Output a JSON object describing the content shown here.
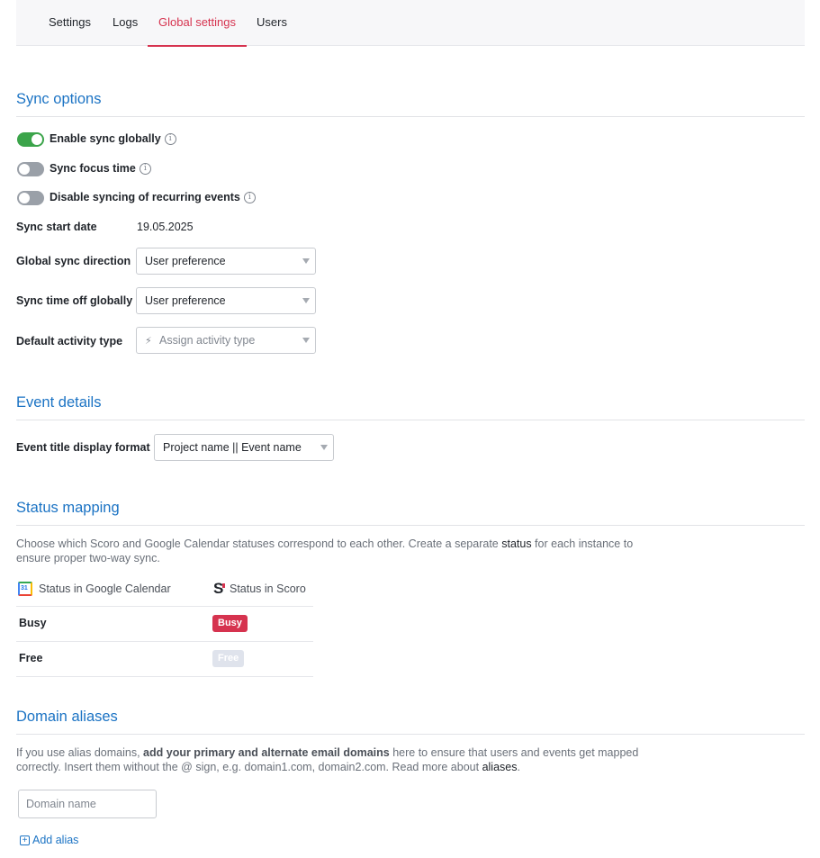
{
  "tabs": [
    {
      "label": "Settings"
    },
    {
      "label": "Logs"
    },
    {
      "label": "Global settings",
      "active": true
    },
    {
      "label": "Users"
    }
  ],
  "sync": {
    "title": "Sync options",
    "toggles": [
      {
        "label": "Enable sync globally",
        "on": true
      },
      {
        "label": "Sync focus time",
        "on": false
      },
      {
        "label": "Disable syncing of recurring events",
        "on": false
      }
    ],
    "start_date_label": "Sync start date",
    "start_date_value": "19.05.2025",
    "direction_label": "Global sync direction",
    "direction_value": "User preference",
    "time_off_label": "Sync time off globally",
    "time_off_value": "User preference",
    "activity_label": "Default activity type",
    "activity_placeholder": "Assign activity type"
  },
  "event": {
    "title": "Event details",
    "format_label": "Event title display format",
    "format_value": "Project name || Event name"
  },
  "status": {
    "title": "Status mapping",
    "desc_1": "Choose which Scoro and Google Calendar statuses correspond to each other. Create a separate ",
    "desc_link": "status",
    "desc_2": " for each instance to ensure proper two-way sync.",
    "col_google": "Status in Google Calendar",
    "col_scoro": "Status in Scoro",
    "gcal_day": "31",
    "scoro_letter": "S",
    "rows": [
      {
        "google": "Busy",
        "scoro": "Busy"
      },
      {
        "google": "Free",
        "scoro": "Free"
      }
    ]
  },
  "domains": {
    "title": "Domain aliases",
    "desc_1": "If you use alias domains, ",
    "desc_bold": "add your primary and alternate email domains",
    "desc_2": " here to ensure that users and events get mapped correctly. Insert them without the @ sign, e.g. domain1.com, domain2.com. Read more about ",
    "desc_link": "aliases",
    "desc_3": ".",
    "input_placeholder": "Domain name",
    "add_label": "Add alias"
  },
  "icons": {
    "info": "info-circle-icon",
    "bolt": "lightning-icon",
    "caret": "caret-down-icon",
    "plus": "plus-square-icon"
  },
  "colors": {
    "accent": "#d6334f",
    "link": "#1b73c4",
    "toggle_on": "#3ba44a",
    "toggle_off": "#9aa0a8"
  }
}
